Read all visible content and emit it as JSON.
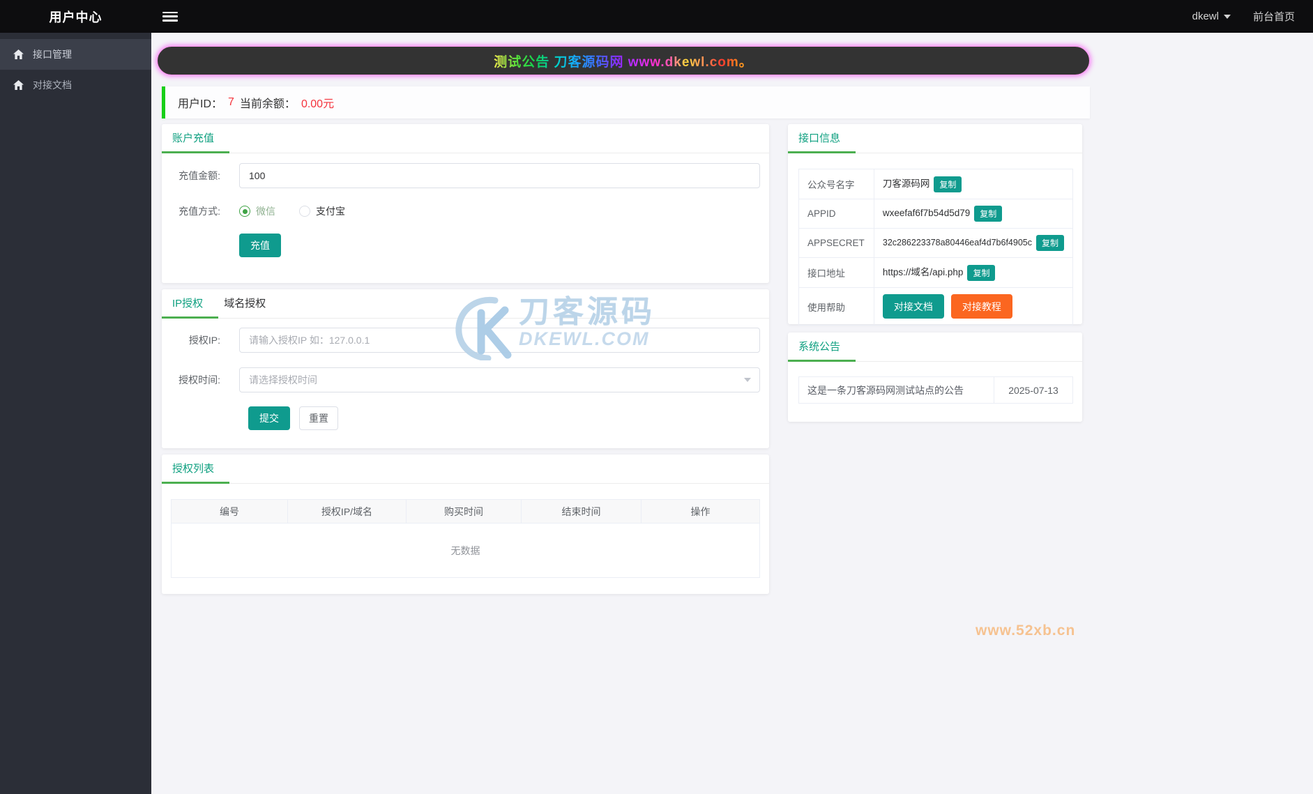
{
  "header": {
    "title": "用户中心",
    "user": "dkewl",
    "home_link": "前台首页"
  },
  "sidebar": {
    "items": [
      {
        "label": "接口管理"
      },
      {
        "label": "对接文档"
      }
    ]
  },
  "banner": {
    "text": "测试公告 刀客源码网 www.dkewl.com。"
  },
  "userbar": {
    "id_label": "用户ID：",
    "id_value": "7",
    "balance_label": "当前余额：",
    "balance_value": "0.00元"
  },
  "recharge": {
    "title": "账户充值",
    "amount_label": "充值金额:",
    "amount_value": "100",
    "method_label": "充值方式:",
    "methods": [
      {
        "label": "微信"
      },
      {
        "label": "支付宝"
      }
    ],
    "selected_method": "微信",
    "submit_label": "充值"
  },
  "auth": {
    "tabs": [
      {
        "label": "IP授权"
      },
      {
        "label": "域名授权"
      }
    ],
    "active_tab": "IP授权",
    "ip_label": "授权IP:",
    "ip_placeholder": "请输入授权IP 如：127.0.0.1",
    "time_label": "授权时间:",
    "time_placeholder": "请选择授权时间",
    "submit_label": "提交",
    "reset_label": "重置"
  },
  "auth_list": {
    "title": "授权列表",
    "headers": [
      "编号",
      "授权IP/域名",
      "购买时间",
      "结束时间",
      "操作"
    ],
    "empty_text": "无数据"
  },
  "api_info": {
    "title": "接口信息",
    "copy_label": "复制",
    "rows": [
      {
        "label": "公众号名字",
        "value": "刀客源码网"
      },
      {
        "label": "APPID",
        "value": "wxeefaf6f7b54d5d79"
      },
      {
        "label": "APPSECRET",
        "value": "32c286223378a80446eaf4d7b6f4905c"
      },
      {
        "label": "接口地址",
        "value": "https://域名/api.php"
      }
    ],
    "help_label": "使用帮助",
    "help_doc_label": "对接文档",
    "help_tutorial_label": "对接教程"
  },
  "system_notice": {
    "title": "系统公告",
    "text": "这是一条刀客源码网测试站点的公告",
    "date": "2025-07-13"
  },
  "watermark": {
    "cn": "刀客源码",
    "en": "DKEWL.COM",
    "corner": "www.52xb.cn"
  },
  "colors": {
    "accent_green": "#0fa080",
    "underline_green": "#4caf50",
    "teal": "#0f9b8e",
    "orange": "#fb6620",
    "red": "#f4333c",
    "userbar_green": "#18cf18"
  }
}
